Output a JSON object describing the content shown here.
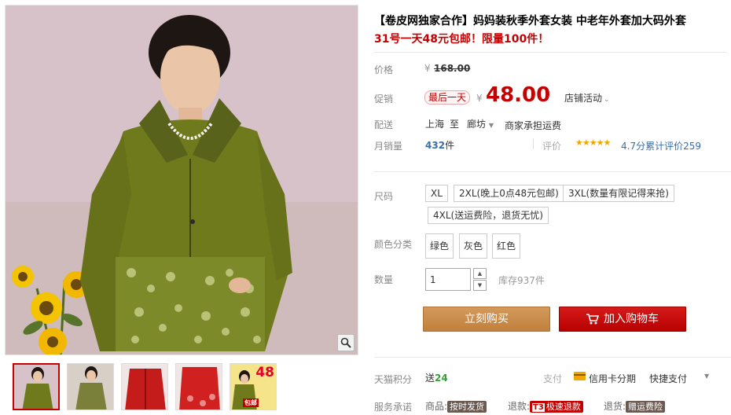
{
  "product": {
    "title": "【卷皮网独家合作】妈妈装秋季外套女装 中老年外套加大码外套",
    "subtitle": "31号一天48元包邮！限量100件！"
  },
  "price": {
    "label": "价格",
    "yen": "¥",
    "original": "168.00"
  },
  "promo": {
    "label": "促销",
    "tag": "最后一天",
    "yen": "¥",
    "price": "48.00",
    "shop_activity": "店铺活动",
    "shop_activity_arrow": "⌄"
  },
  "delivery": {
    "label": "配送",
    "from": "上海",
    "to_word": "至",
    "dest": "廊坊",
    "dest_arrow": "▼",
    "shipping": "商家承担运费"
  },
  "sales": {
    "label": "月销量",
    "count": "432",
    "unit": "件",
    "rating_label": "评价",
    "stars": "★★★★★",
    "rating_text": "4.7分累计评价259"
  },
  "size": {
    "label": "尺码",
    "options": [
      "XL",
      "2XL(晚上0点48元包邮)",
      "3XL(数量有限记得来抢)",
      "4XL(送运费险，退货无忧)"
    ]
  },
  "color": {
    "label": "颜色分类",
    "options": [
      "绿色",
      "灰色",
      "红色"
    ]
  },
  "quantity": {
    "label": "数量",
    "value": "1",
    "up": "▲",
    "down": "▼",
    "stock": "库存937件"
  },
  "actions": {
    "buy_now": "立刻购买",
    "add_to_cart": "加入购物车"
  },
  "tmall_points": {
    "label": "天猫积分",
    "text": "送",
    "value": "24"
  },
  "payment": {
    "label": "支付",
    "card": "信用卡分期",
    "quick": "快捷支付",
    "arrow": "▼"
  },
  "service": {
    "label": "服务承诺",
    "goods_label": "商品:",
    "goods_tag": "按时发货",
    "refund_label": "退款:",
    "refund_t3": "T3",
    "refund_tag": "极速退款",
    "return_label": "退货:",
    "return_tag": "赠运费险"
  },
  "thumbnails": {
    "t5_price": "48",
    "t5_badge": "包邮"
  },
  "colors": {
    "accent_red": "#c40000",
    "buy_orange": "#c98e4f",
    "jacket_green": "#6f7a1c",
    "link_blue": "#3a6ea5"
  },
  "icons": [
    "zoom-icon",
    "cart-icon",
    "credit-card-icon",
    "chevron-down-icon"
  ]
}
